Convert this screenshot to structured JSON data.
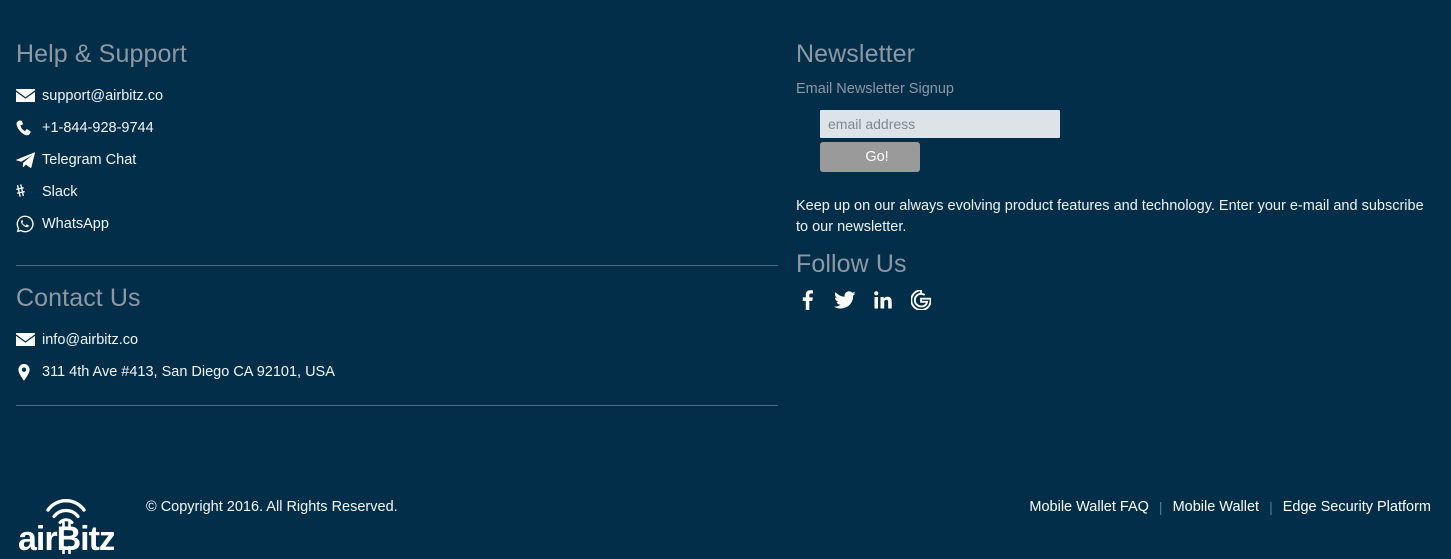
{
  "theme": {
    "background": "#032e4a",
    "heading_color": "#8d98a2",
    "text_color": "#f2f5f7",
    "divider_color": "#4d6e84",
    "input_background": "#dce4e8",
    "button_background": "#9a9a9a"
  },
  "help": {
    "heading": "Help & Support",
    "items": [
      {
        "icon": "envelope-icon",
        "label": "support@airbitz.co"
      },
      {
        "icon": "phone-icon",
        "label": "+1-844-928-9744"
      },
      {
        "icon": "telegram-icon",
        "label": "Telegram Chat"
      },
      {
        "icon": "slack-icon",
        "label": "Slack"
      },
      {
        "icon": "whatsapp-icon",
        "label": "WhatsApp"
      }
    ]
  },
  "contact": {
    "heading": "Contact Us",
    "items": [
      {
        "icon": "envelope-icon",
        "label": "info@airbitz.co"
      },
      {
        "icon": "map-pin-icon",
        "label": "311 4th Ave #413, San Diego CA 92101, USA"
      }
    ]
  },
  "newsletter": {
    "heading": "Newsletter",
    "label": "Email Newsletter Signup",
    "input_value": "",
    "input_placeholder": "email address",
    "button_label": "Go!",
    "description": "Keep up on our always evolving product features and technology. Enter your e-mail and subscribe to our newsletter."
  },
  "follow": {
    "heading": "Follow Us",
    "items": [
      {
        "icon": "facebook-icon",
        "name": "Facebook"
      },
      {
        "icon": "twitter-icon",
        "name": "Twitter"
      },
      {
        "icon": "linkedin-icon",
        "name": "LinkedIn"
      },
      {
        "icon": "google-icon",
        "name": "Google"
      }
    ]
  },
  "bottom": {
    "logo_text": "airBitz",
    "copyright": "© Copyright 2016. All Rights Reserved.",
    "separator": "|",
    "links": [
      {
        "label": "Mobile Wallet FAQ"
      },
      {
        "label": "Mobile Wallet"
      },
      {
        "label": "Edge Security Platform"
      }
    ]
  }
}
